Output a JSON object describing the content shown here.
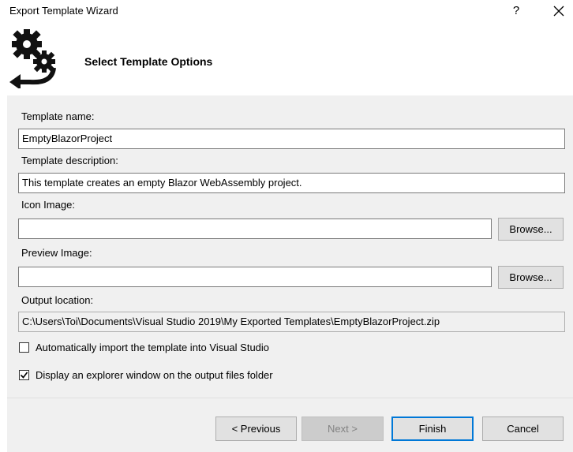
{
  "window": {
    "title": "Export Template Wizard",
    "help_label": "?",
    "close_label": "✕"
  },
  "header": {
    "heading": "Select Template Options",
    "icon": "gear-arrow-icon"
  },
  "form": {
    "template_name_label": "Template name:",
    "template_name_value": "EmptyBlazorProject",
    "template_description_label": "Template description:",
    "template_description_value": "This template creates an empty Blazor WebAssembly project.",
    "icon_image_label": "Icon Image:",
    "icon_image_value": "",
    "icon_browse_label": "Browse...",
    "preview_image_label": "Preview Image:",
    "preview_image_value": "",
    "preview_browse_label": "Browse...",
    "output_location_label": "Output location:",
    "output_location_value": "C:\\Users\\Toi\\Documents\\Visual Studio 2019\\My Exported Templates\\EmptyBlazorProject.zip",
    "auto_import_label": "Automatically import the template into Visual Studio",
    "auto_import_checked": false,
    "explorer_label": "Display an explorer window on the output files folder",
    "explorer_checked": true
  },
  "footer": {
    "previous_label": "< Previous",
    "next_label": "Next >",
    "finish_label": "Finish",
    "cancel_label": "Cancel"
  },
  "colors": {
    "panel_bg": "#f0f0f0",
    "accent": "#0078d7",
    "button_bg": "#e1e1e1"
  }
}
